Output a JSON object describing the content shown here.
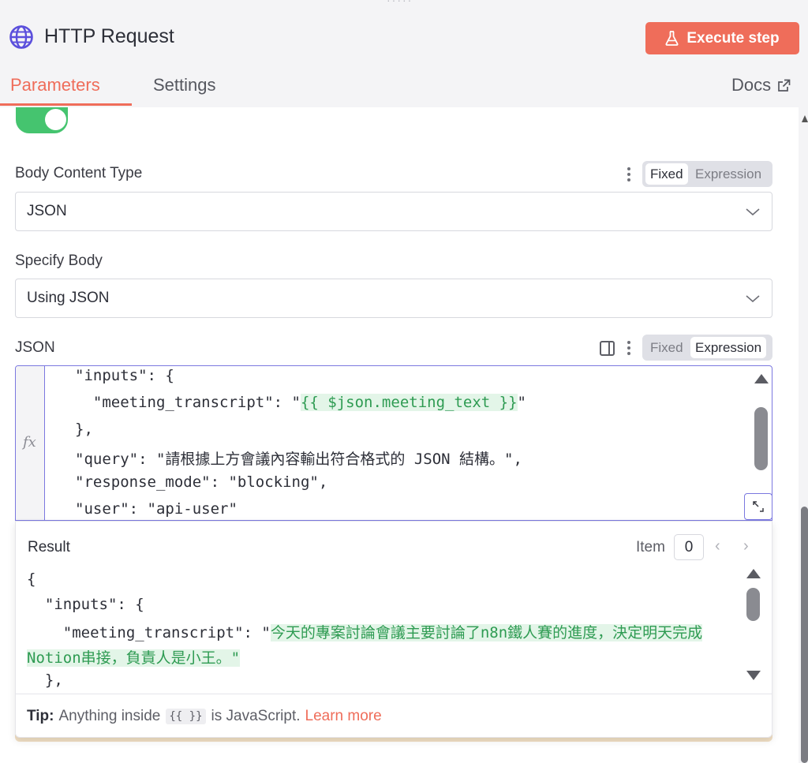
{
  "header": {
    "drag_hint": "·····",
    "title": "HTTP Request",
    "execute_label": "Execute step"
  },
  "tabs": {
    "parameters": "Parameters",
    "settings": "Settings",
    "docs": "Docs"
  },
  "toggle": {
    "on": true
  },
  "body_content_type": {
    "label": "Body Content Type",
    "value": "JSON",
    "mode_fixed": "Fixed",
    "mode_expression": "Expression",
    "active_mode": "Fixed"
  },
  "specify_body": {
    "label": "Specify Body",
    "value": "Using JSON"
  },
  "json_field": {
    "label": "JSON",
    "mode_fixed": "Fixed",
    "mode_expression": "Expression",
    "active_mode": "Expression",
    "gutter_mark": "fx",
    "lines": {
      "l1": "\"inputs\": {",
      "l2_pre": "  \"meeting_transcript\": \"",
      "l2_tpl": "{{ $json.meeting_text }}",
      "l2_post": "\"",
      "l3": "},",
      "l4": "\"query\": \"請根據上方會議內容輸出符合格式的 JSON 結構。\",",
      "l5": "\"response_mode\": \"blocking\",",
      "l6": "\"user\": \"api-user\""
    }
  },
  "result": {
    "title": "Result",
    "item_label": "Item",
    "item_value": "0",
    "lines": {
      "l1": "{",
      "l2": "  \"inputs\": {",
      "l3_pre": "    \"meeting_transcript\": \"",
      "l3_str": "今天的專案討論會議主要討論了n8n鐵人賽的進度，決定明天完成",
      "l4_str": "Notion串接，負責人是小王。",
      "l4_post": "\"",
      "l5": "  },"
    }
  },
  "tip": {
    "label": "Tip:",
    "text_before": "Anything inside",
    "code": "{{ }}",
    "text_after": "is JavaScript.",
    "link": "Learn more"
  },
  "colors": {
    "accent": "#ef6d5a",
    "toggle_on": "#45c46f",
    "expression_border": "#7b78e0",
    "template_green": "#2e9b52"
  }
}
